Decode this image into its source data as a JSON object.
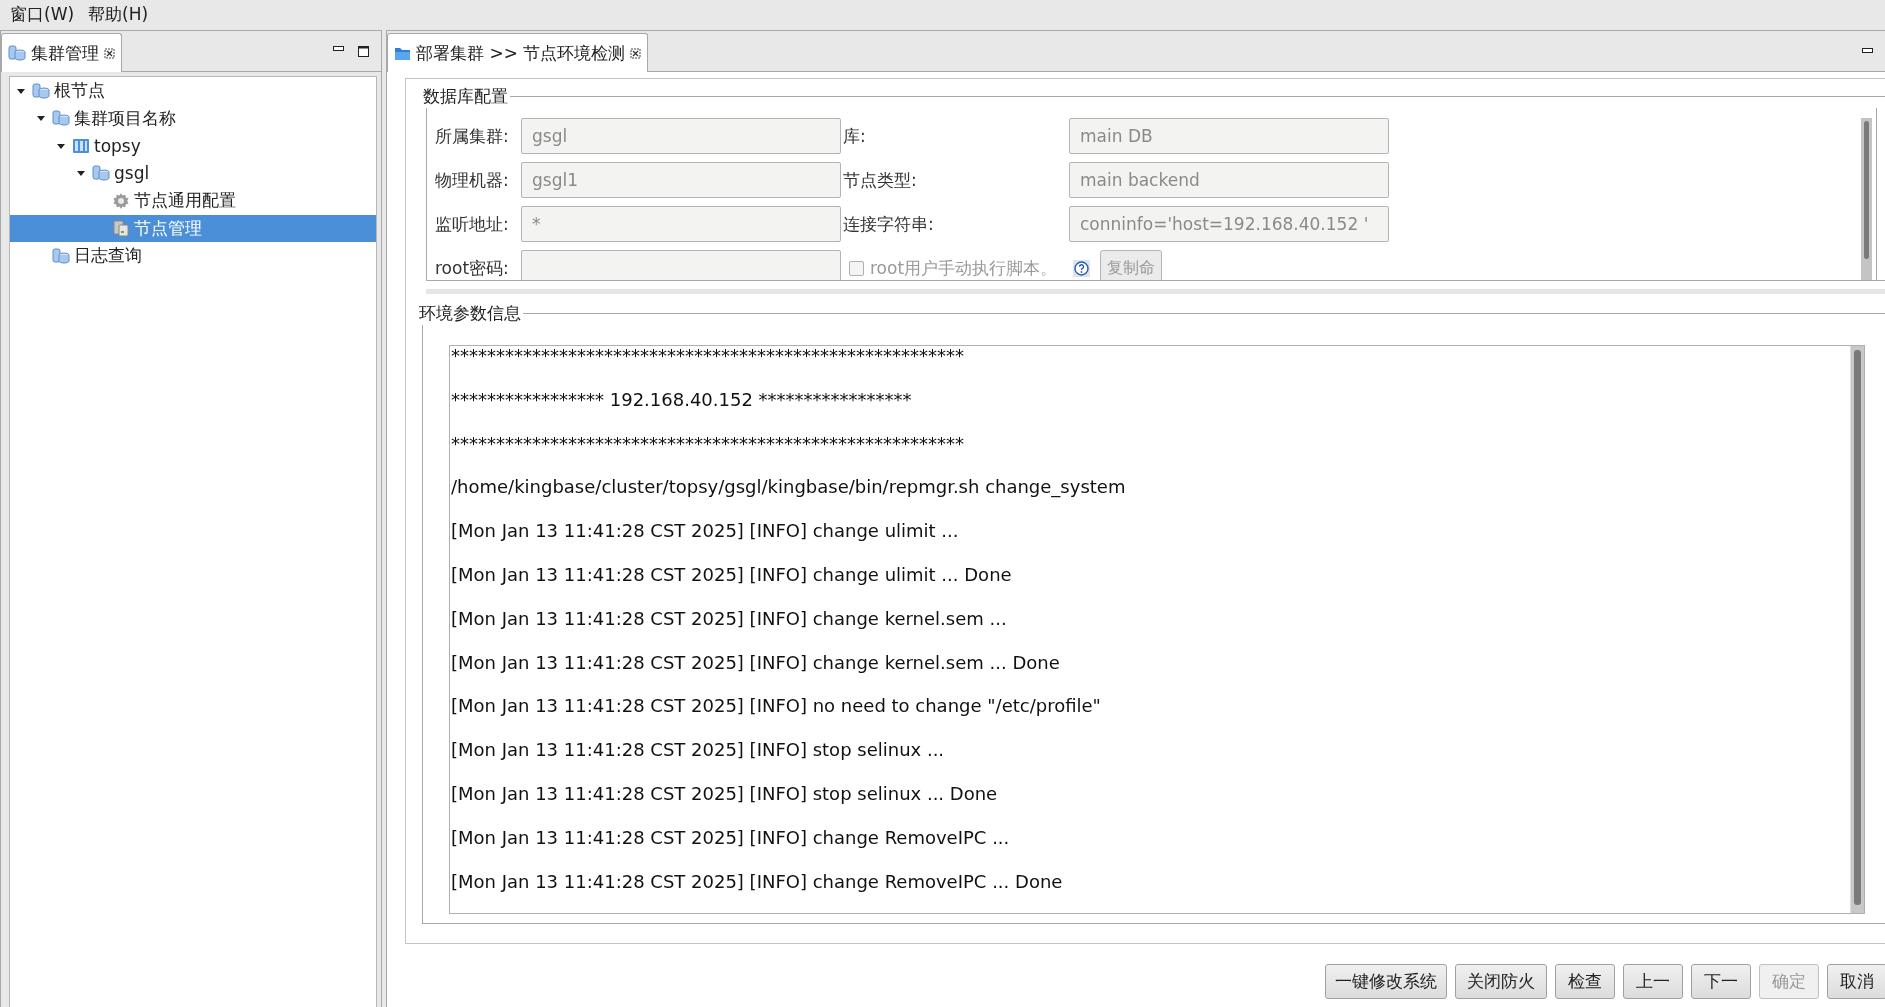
{
  "menu": [
    {
      "label": "窗口(W)"
    },
    {
      "label": "帮助(H)"
    }
  ],
  "left_panel": {
    "tab": {
      "title": "集群管理",
      "selected": true
    },
    "tree": [
      {
        "label": "根节点",
        "kind": "db",
        "expanded": true,
        "selected": false,
        "children": [
          {
            "label": "集群项目名称",
            "kind": "db",
            "expanded": true,
            "selected": false,
            "children": [
              {
                "label": "topsy",
                "kind": "server",
                "expanded": true,
                "selected": false,
                "children": [
                  {
                    "label": "gsgl",
                    "kind": "db",
                    "expanded": true,
                    "selected": false,
                    "children": [
                      {
                        "label": "节点通用配置",
                        "kind": "gear",
                        "selected": false
                      },
                      {
                        "label": "节点管理",
                        "kind": "node",
                        "selected": true
                      }
                    ]
                  }
                ]
              }
            ]
          },
          {
            "label": "日志查询",
            "kind": "db",
            "selected": false
          }
        ]
      }
    ]
  },
  "editor": {
    "tab": {
      "title": "部署集群 >> 节点环境检测",
      "selected": true
    },
    "db_config": {
      "title": "数据库配置",
      "items": [
        {
          "kind": "field",
          "label": "所属集群:",
          "value": "gsgl"
        },
        {
          "kind": "field",
          "label": "库:",
          "value": "main DB"
        },
        {
          "kind": "field",
          "label": "物理机器:",
          "value": "gsgl1"
        },
        {
          "kind": "field",
          "label": "节点类型:",
          "value": "main backend"
        },
        {
          "kind": "field",
          "label": "监听地址:",
          "value": "*"
        },
        {
          "kind": "field",
          "label": "连接字符串:",
          "value": "conninfo='host=192.168.40.152 '"
        },
        {
          "kind": "field",
          "label": "root密码:"
        },
        {
          "kind": "checkbox",
          "label": "root用户手动执行脚本。",
          "checked": false,
          "disabled": true,
          "button": "复制命"
        }
      ]
    },
    "env_info": {
      "title": "环境参数信息",
      "lines": [
        "*********************************************************",
        "***************** 192.168.40.152 *****************",
        "*********************************************************",
        "/home/kingbase/cluster/topsy/gsgl/kingbase/bin/repmgr.sh change_system",
        "[Mon Jan 13 11:41:28 CST 2025] [INFO] change ulimit ...",
        "[Mon Jan 13 11:41:28 CST 2025] [INFO] change ulimit ... Done",
        "[Mon Jan 13 11:41:28 CST 2025] [INFO] change kernel.sem ...",
        "[Mon Jan 13 11:41:28 CST 2025] [INFO] change kernel.sem ... Done",
        "[Mon Jan 13 11:41:28 CST 2025] [INFO] no need to change \"/etc/profile\"",
        "[Mon Jan 13 11:41:28 CST 2025] [INFO] stop selinux ...",
        "[Mon Jan 13 11:41:28 CST 2025] [INFO] stop selinux ... Done",
        "[Mon Jan 13 11:41:28 CST 2025] [INFO] change RemoveIPC ...",
        "[Mon Jan 13 11:41:28 CST 2025] [INFO] change RemoveIPC ... Done"
      ]
    },
    "buttons": [
      {
        "label": "一键修改系统",
        "disabled": false
      },
      {
        "label": "关闭防火",
        "disabled": false
      },
      {
        "label": "检查",
        "disabled": false
      },
      {
        "label": "上一",
        "disabled": false
      },
      {
        "label": "下一",
        "disabled": false
      },
      {
        "label": "确定",
        "disabled": true
      },
      {
        "label": "取消",
        "disabled": false
      }
    ]
  }
}
